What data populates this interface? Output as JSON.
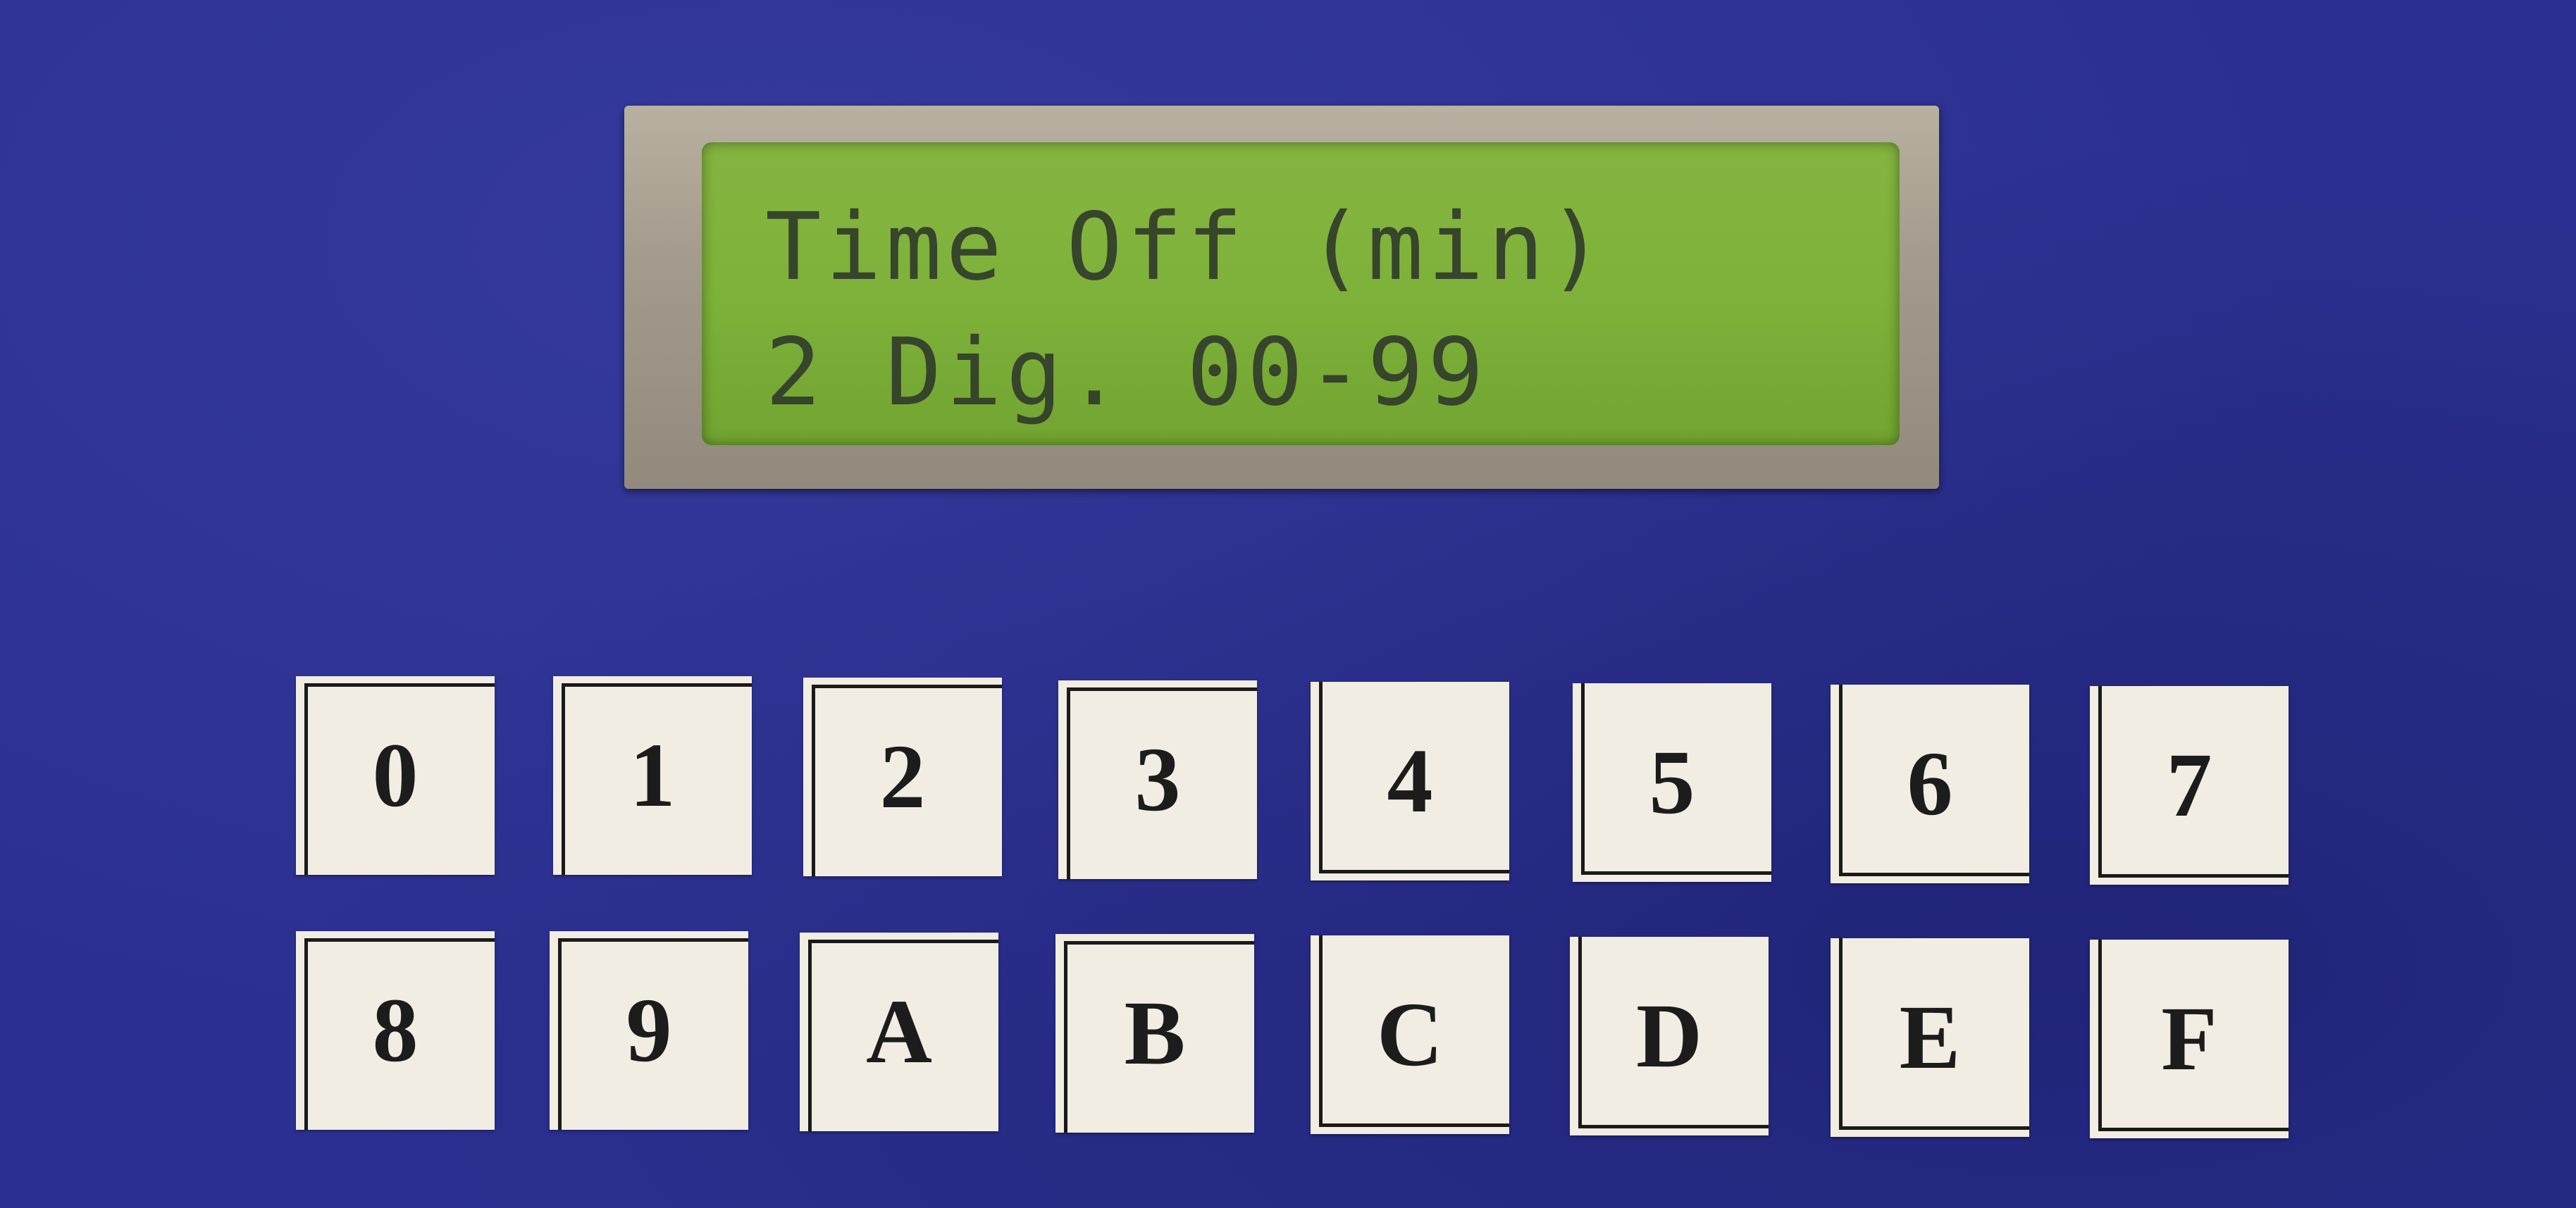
{
  "display": {
    "line1": "Time Off (min)",
    "line2": "2 Dig. 00-99"
  },
  "keypad": {
    "row1": [
      "0",
      "1",
      "2",
      "3",
      "4",
      "5",
      "6",
      "7"
    ],
    "row2": [
      "8",
      "9",
      "A",
      "B",
      "C",
      "D",
      "E",
      "F"
    ]
  },
  "colors": {
    "panel": "#2b3090",
    "lcd": "#7eb23a",
    "key": "#f1ede2"
  }
}
